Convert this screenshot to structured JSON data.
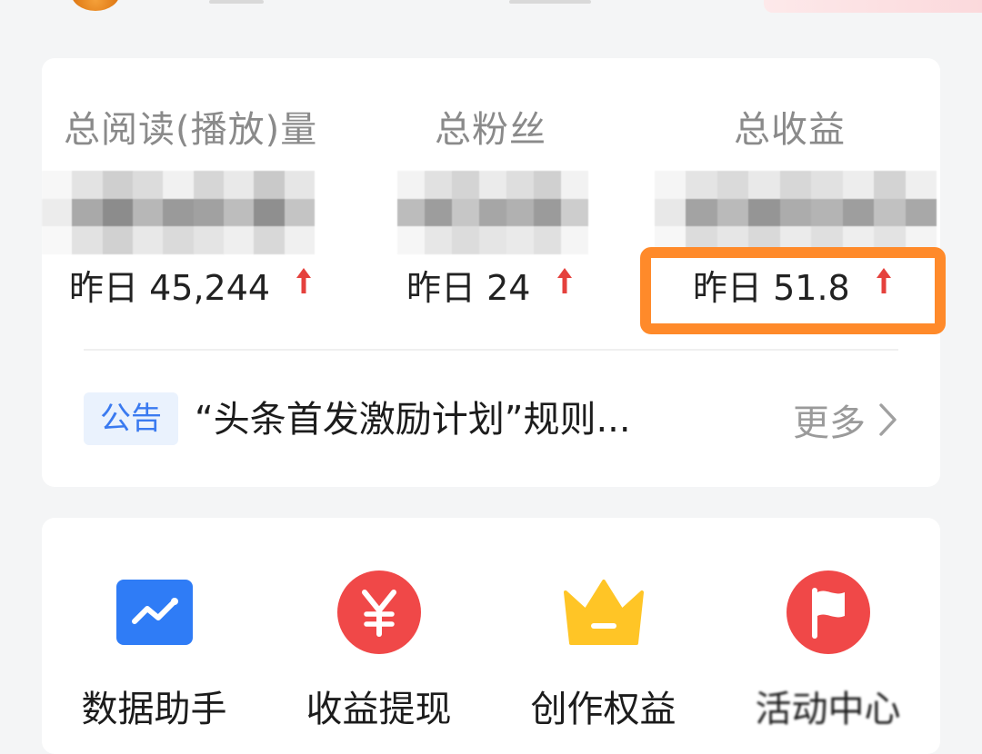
{
  "stats": [
    {
      "label": "总阅读(播放)量",
      "yesterday_prefix": "昨日",
      "yesterday_value": "45,244",
      "trend": "up"
    },
    {
      "label": "总粉丝",
      "yesterday_prefix": "昨日",
      "yesterday_value": "24",
      "trend": "up"
    },
    {
      "label": "总收益",
      "yesterday_prefix": "昨日",
      "yesterday_value": "51.8",
      "trend": "up"
    }
  ],
  "notice": {
    "tag": "公告",
    "text": "“头条首发激励计划”规则...",
    "more_label": "更多"
  },
  "tools": [
    {
      "label": "数据助手",
      "icon": "data-chart-icon"
    },
    {
      "label": "收益提现",
      "icon": "yuan-coin-icon"
    },
    {
      "label": "创作权益",
      "icon": "crown-icon"
    },
    {
      "label": "活动中心",
      "icon": "flag-icon"
    }
  ],
  "colors": {
    "page_bg": "#f4f5f6",
    "card_bg": "#ffffff",
    "label_gray": "#8a8a8a",
    "trend_up_red": "#e5413d",
    "highlight_orange": "#ff8a2a",
    "notice_tag_bg": "#eaf2fd",
    "notice_tag_text": "#3a7af0",
    "data_icon_blue": "#2f7cf6",
    "yuan_icon_red": "#f04848",
    "crown_icon_yellow": "#ffc526",
    "flag_icon_red": "#f04848"
  }
}
